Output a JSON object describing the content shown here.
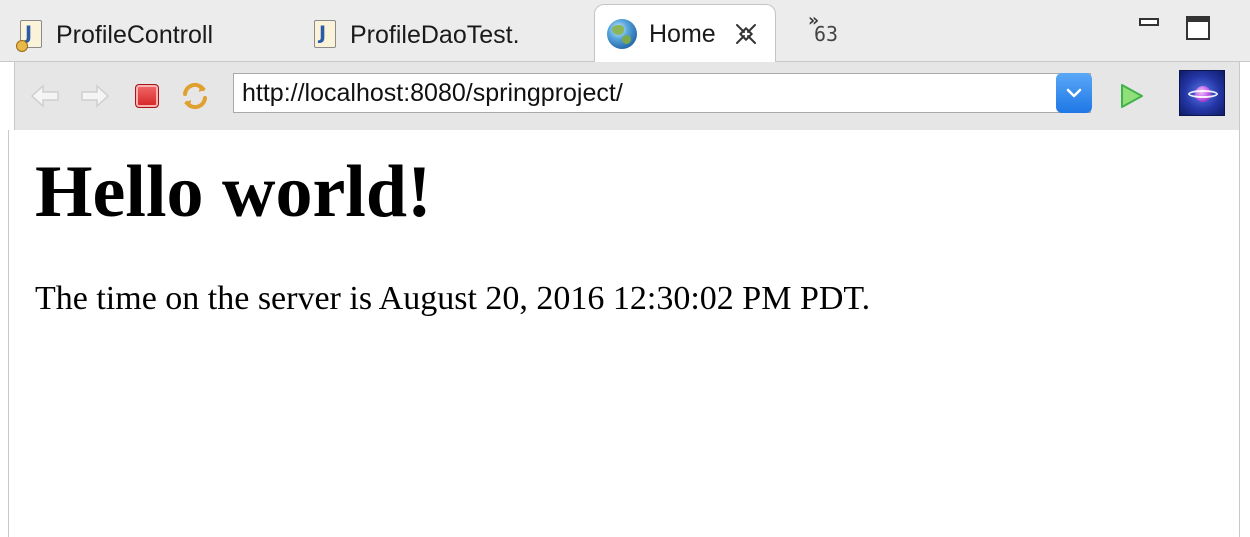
{
  "tabs": [
    {
      "label": "ProfileControll",
      "icon": "java-file-icon",
      "icon_letter": "J",
      "active": false
    },
    {
      "label": "ProfileDaoTest.",
      "icon": "java-file-icon",
      "icon_letter": "J",
      "active": false
    },
    {
      "label": "Home",
      "icon": "globe-icon",
      "active": true
    }
  ],
  "overflow": {
    "chevron": "»",
    "count": "63"
  },
  "toolbar": {
    "url": "http://localhost:8080/springproject/",
    "icons": [
      "back-arrow-icon",
      "forward-arrow-icon",
      "stop-icon",
      "refresh-icon",
      "dropdown-chevron-icon",
      "go-icon",
      "browser-logo-icon"
    ]
  },
  "page": {
    "heading": "Hello world!",
    "text": "The time on the server is August 20, 2016 12:30:02 PM PDT."
  },
  "colors": {
    "stop_red": "#d42424",
    "go_green": "#3fb24a",
    "dropdown_blue": "#1f77e6",
    "refresh_orange": "#e0a030"
  }
}
